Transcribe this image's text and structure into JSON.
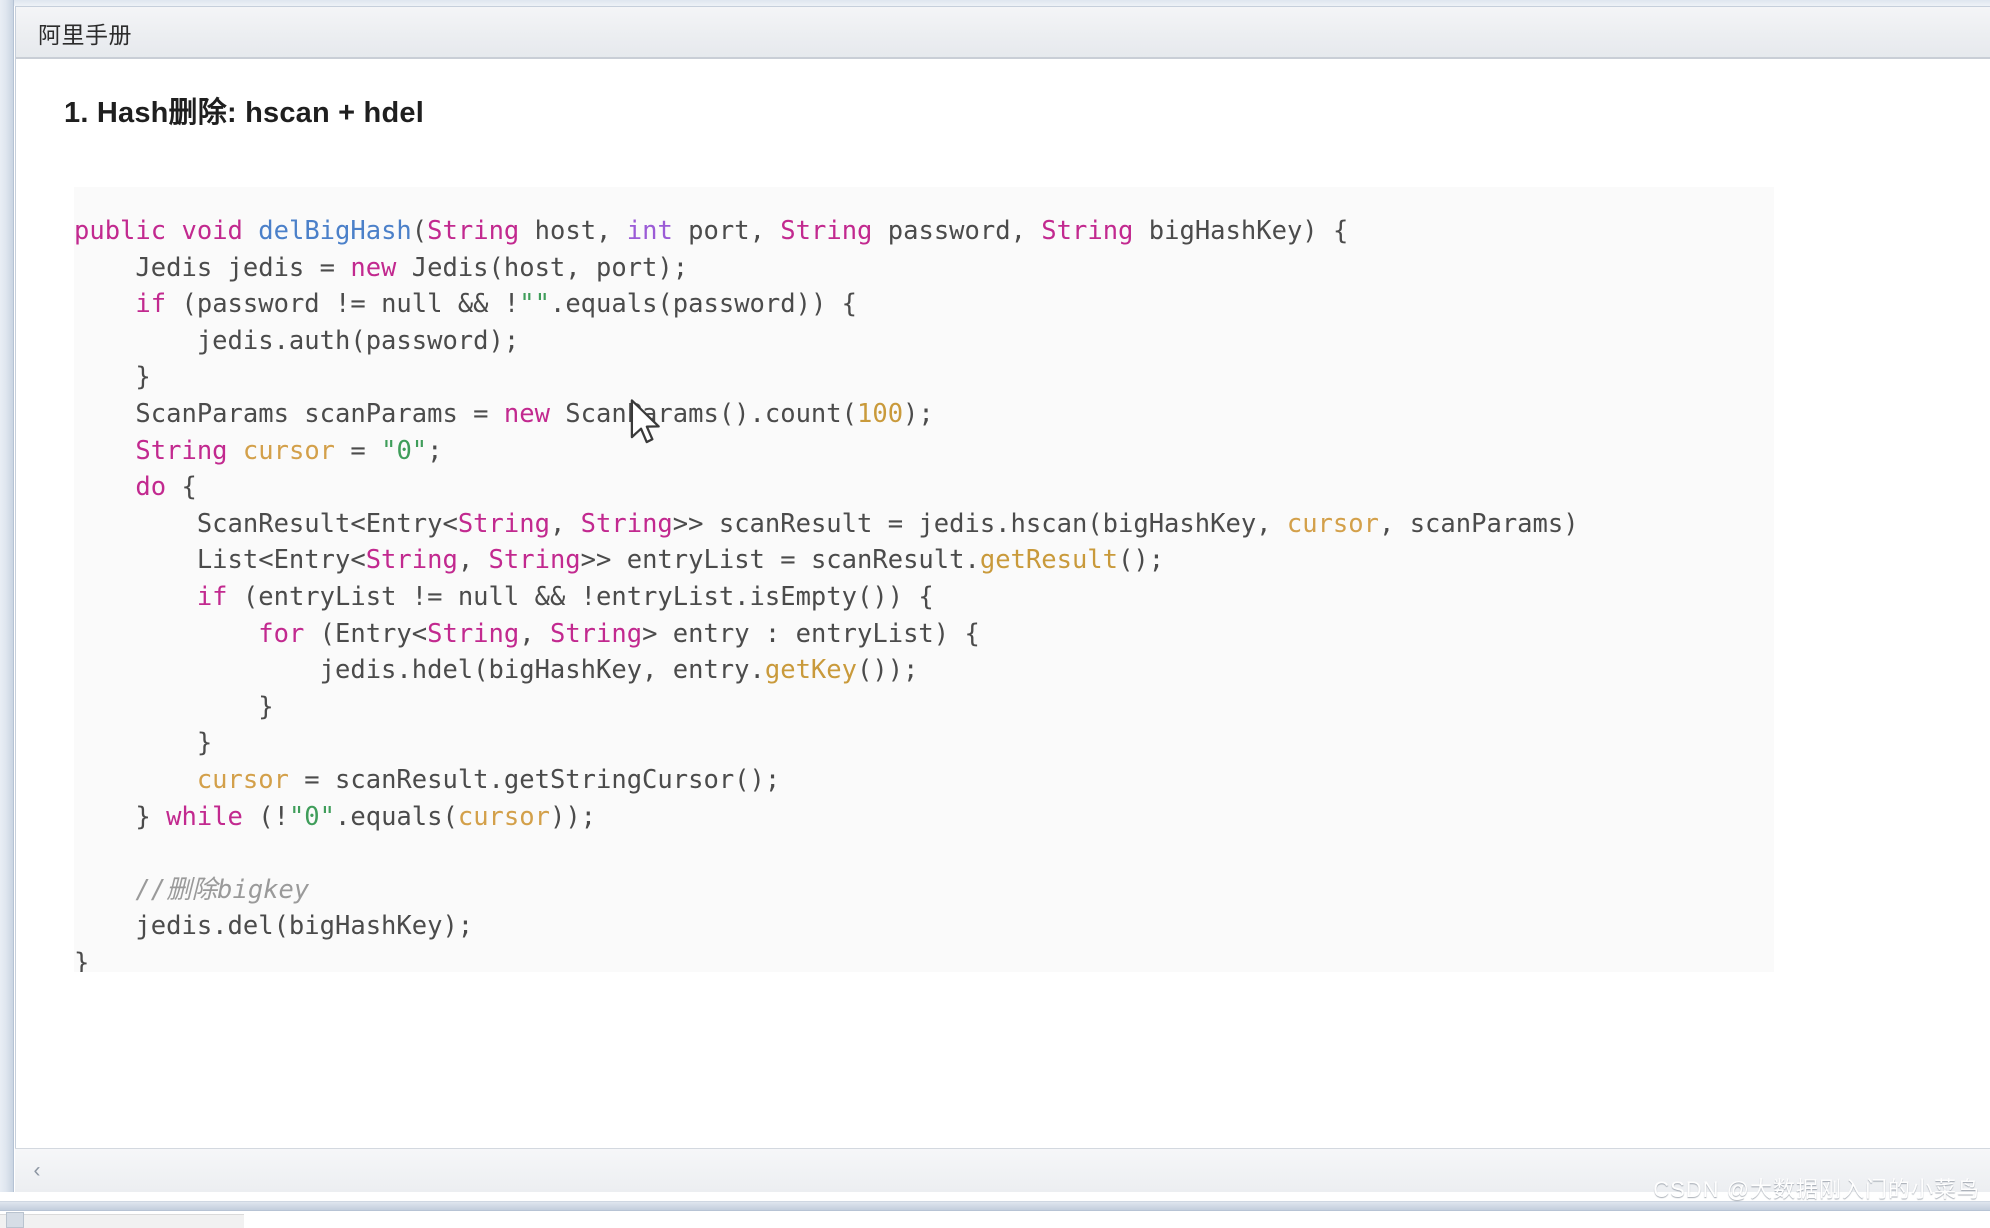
{
  "window": {
    "tab_label": "阿里手册"
  },
  "document": {
    "heading": "1. Hash删除: hscan + hdel",
    "code_lines": [
      [
        {
          "t": "public",
          "c": "kw"
        },
        {
          "t": " ",
          "c": "pln"
        },
        {
          "t": "void",
          "c": "kw"
        },
        {
          "t": " ",
          "c": "pln"
        },
        {
          "t": "delBigHash",
          "c": "fn"
        },
        {
          "t": "(",
          "c": "pln"
        },
        {
          "t": "String",
          "c": "typ"
        },
        {
          "t": " host, ",
          "c": "pln"
        },
        {
          "t": "int",
          "c": "typb"
        },
        {
          "t": " port, ",
          "c": "pln"
        },
        {
          "t": "String",
          "c": "typ"
        },
        {
          "t": " password, ",
          "c": "pln"
        },
        {
          "t": "String",
          "c": "typ"
        },
        {
          "t": " bigHashKey) {",
          "c": "pln"
        }
      ],
      [
        {
          "t": "    Jedis jedis = ",
          "c": "pln"
        },
        {
          "t": "new",
          "c": "kw"
        },
        {
          "t": " Jedis(host, port);",
          "c": "pln"
        }
      ],
      [
        {
          "t": "    ",
          "c": "pln"
        },
        {
          "t": "if",
          "c": "kw"
        },
        {
          "t": " (password != null && !",
          "c": "pln"
        },
        {
          "t": "\"\"",
          "c": "str"
        },
        {
          "t": ".equals(password)) {",
          "c": "pln"
        }
      ],
      [
        {
          "t": "        jedis.auth(password);",
          "c": "pln"
        }
      ],
      [
        {
          "t": "    }",
          "c": "pln"
        }
      ],
      [
        {
          "t": "    ScanParams scanParams = ",
          "c": "pln"
        },
        {
          "t": "new",
          "c": "kw"
        },
        {
          "t": " ScanParams().count(",
          "c": "pln"
        },
        {
          "t": "100",
          "c": "num"
        },
        {
          "t": ");",
          "c": "pln"
        }
      ],
      [
        {
          "t": "    ",
          "c": "pln"
        },
        {
          "t": "String",
          "c": "typ"
        },
        {
          "t": " ",
          "c": "pln"
        },
        {
          "t": "cursor",
          "c": "var"
        },
        {
          "t": " = ",
          "c": "pln"
        },
        {
          "t": "\"0\"",
          "c": "str"
        },
        {
          "t": ";",
          "c": "pln"
        }
      ],
      [
        {
          "t": "    ",
          "c": "pln"
        },
        {
          "t": "do",
          "c": "kw"
        },
        {
          "t": " {",
          "c": "pln"
        }
      ],
      [
        {
          "t": "        ScanResult<Entry<",
          "c": "pln"
        },
        {
          "t": "String",
          "c": "typ"
        },
        {
          "t": ", ",
          "c": "pln"
        },
        {
          "t": "String",
          "c": "typ"
        },
        {
          "t": ">> scanResult = jedis.hscan(bigHashKey, ",
          "c": "pln"
        },
        {
          "t": "cursor",
          "c": "var"
        },
        {
          "t": ", scanParams)",
          "c": "pln"
        }
      ],
      [
        {
          "t": "        List<Entry<",
          "c": "pln"
        },
        {
          "t": "String",
          "c": "typ"
        },
        {
          "t": ", ",
          "c": "pln"
        },
        {
          "t": "String",
          "c": "typ"
        },
        {
          "t": ">> entryList = scanResult.",
          "c": "pln"
        },
        {
          "t": "getResult",
          "c": "call"
        },
        {
          "t": "();",
          "c": "pln"
        }
      ],
      [
        {
          "t": "        ",
          "c": "pln"
        },
        {
          "t": "if",
          "c": "kw"
        },
        {
          "t": " (entryList != null && !entryList.isEmpty()) {",
          "c": "pln"
        }
      ],
      [
        {
          "t": "            ",
          "c": "pln"
        },
        {
          "t": "for",
          "c": "kw"
        },
        {
          "t": " (Entry<",
          "c": "pln"
        },
        {
          "t": "String",
          "c": "typ"
        },
        {
          "t": ", ",
          "c": "pln"
        },
        {
          "t": "String",
          "c": "typ"
        },
        {
          "t": "> entry : entryList) {",
          "c": "pln"
        }
      ],
      [
        {
          "t": "                jedis.hdel(bigHashKey, entry.",
          "c": "pln"
        },
        {
          "t": "getKey",
          "c": "call"
        },
        {
          "t": "());",
          "c": "pln"
        }
      ],
      [
        {
          "t": "            }",
          "c": "pln"
        }
      ],
      [
        {
          "t": "        }",
          "c": "pln"
        }
      ],
      [
        {
          "t": "        ",
          "c": "pln"
        },
        {
          "t": "cursor",
          "c": "var"
        },
        {
          "t": " = scanResult.getStringCursor();",
          "c": "pln"
        }
      ],
      [
        {
          "t": "    } ",
          "c": "pln"
        },
        {
          "t": "while",
          "c": "kw"
        },
        {
          "t": " (!",
          "c": "pln"
        },
        {
          "t": "\"0\"",
          "c": "str"
        },
        {
          "t": ".equals(",
          "c": "pln"
        },
        {
          "t": "cursor",
          "c": "var"
        },
        {
          "t": "));",
          "c": "pln"
        }
      ],
      [
        {
          "t": "",
          "c": "pln"
        }
      ],
      [
        {
          "t": "    //删除bigkey",
          "c": "cmt"
        }
      ],
      [
        {
          "t": "    jedis.del(bigHashKey);",
          "c": "pln"
        }
      ],
      [
        {
          "t": "}",
          "c": "pln"
        }
      ]
    ]
  },
  "bottombar": {
    "scroll_left_label": "‹"
  },
  "watermark": {
    "text": "CSDN @大数据刚入门的小菜鸟"
  },
  "colors": {
    "keyword": "#c2298f",
    "type": "#c2298f",
    "primitive_type": "#9b5bd6",
    "method_decl": "#4b80c9",
    "method_call": "#c99a3b",
    "number": "#c99a3b",
    "variable": "#d3a04a",
    "string": "#3f9d5a",
    "comment": "#9a9a9a",
    "plain": "#4b4b4b",
    "code_bg": "#fafafa",
    "tab_bg": "#eceef1"
  }
}
